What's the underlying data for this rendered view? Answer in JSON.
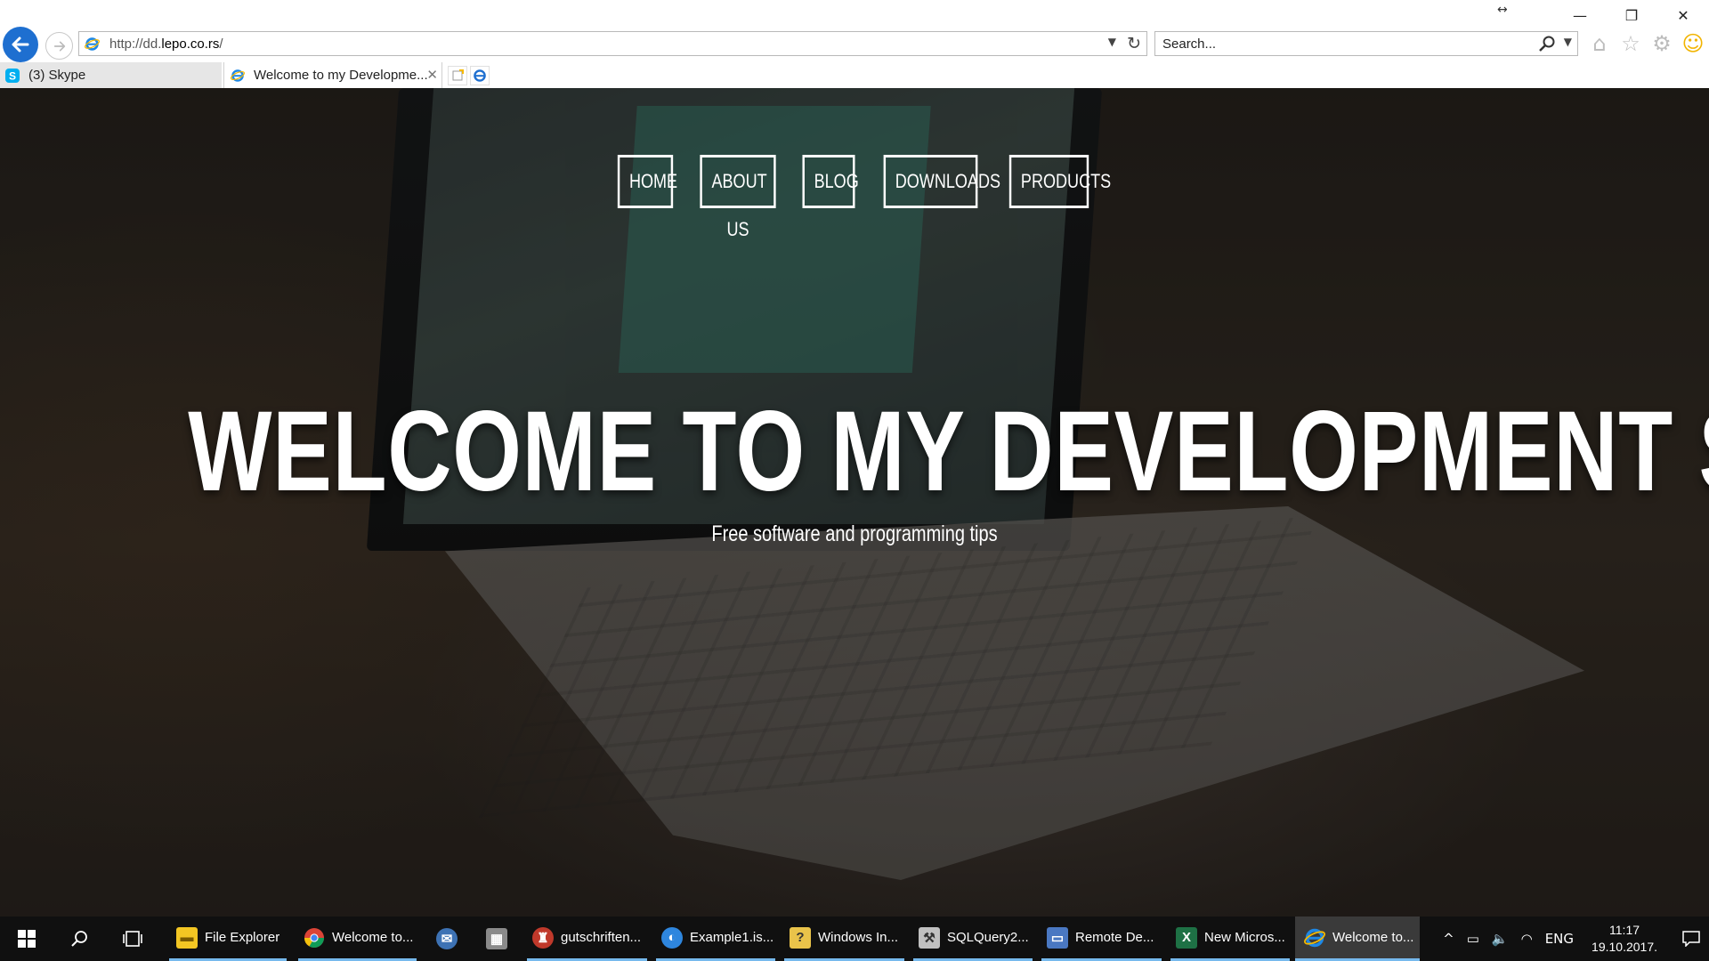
{
  "browser": {
    "address_url_prefix": "http://dd.",
    "address_url_domain": "lepo.co.rs",
    "address_url_suffix": "/",
    "search_placeholder": "Search...",
    "tabs": [
      {
        "label": "(3) Skype",
        "icon": "skype-icon"
      },
      {
        "label": "Welcome to my Developme...",
        "icon": "ie-icon",
        "active": true
      }
    ],
    "window_controls": {
      "minimize": "—",
      "restore": "❐",
      "close": "✕"
    },
    "resize_hint": "↔"
  },
  "site": {
    "nav": [
      "HOME",
      "ABOUT US",
      "BLOG",
      "DOWNLOADS",
      "PRODUCTS"
    ],
    "hero_title": "WELCOME TO MY DEVELOPMENT SITE!",
    "hero_subtitle": "Free software and programming tips"
  },
  "taskbar": {
    "items": [
      {
        "label": "File Explorer",
        "icon": "folder-icon",
        "color": "#f3c623",
        "open": true
      },
      {
        "label": "Welcome to...",
        "icon": "chrome-icon",
        "color": "#db4437",
        "open": true
      },
      {
        "label": "",
        "icon": "thunderbird-icon",
        "color": "#3d72b4",
        "open": false
      },
      {
        "label": "",
        "icon": "calculator-icon",
        "color": "#8a8a8a",
        "open": false
      },
      {
        "label": "gutschriften...",
        "icon": "gladiator-icon",
        "color": "#c0392b",
        "open": true
      },
      {
        "label": "Example1.is...",
        "icon": "innosetup-icon",
        "color": "#2e86de",
        "open": true
      },
      {
        "label": "Windows In...",
        "icon": "installer-icon",
        "color": "#e9c34a",
        "open": true
      },
      {
        "label": "SQLQuery2...",
        "icon": "sql-icon",
        "color": "#c0c0c0",
        "open": true
      },
      {
        "label": "Remote De...",
        "icon": "remote-desktop-icon",
        "color": "#4a78c2",
        "open": true
      },
      {
        "label": "New Micros...",
        "icon": "excel-icon",
        "color": "#1e7145",
        "open": true
      },
      {
        "label": "Welcome to...",
        "icon": "ie-icon",
        "color": "#1e88e5",
        "open": true,
        "current": true
      }
    ],
    "tray": {
      "chevron": "^",
      "language": "ENG"
    },
    "clock_time": "11:17",
    "clock_date": "19.10.2017."
  }
}
